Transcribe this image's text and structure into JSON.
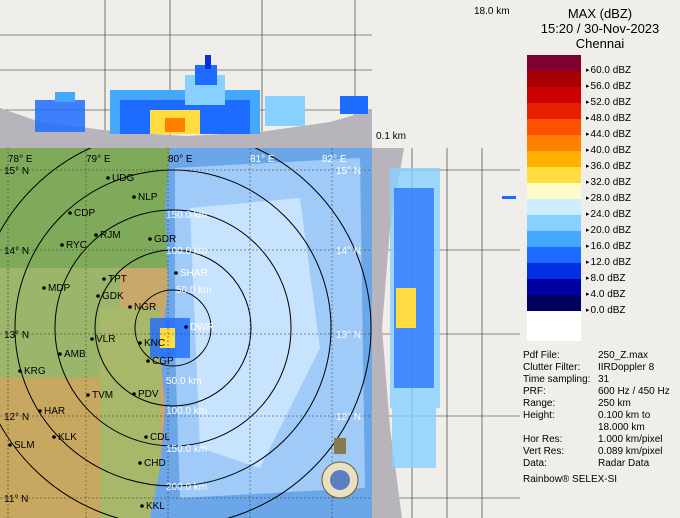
{
  "header": {
    "product": "MAX (dBZ)",
    "datetime": "15:20 / 30-Nov-2023",
    "station": "Chennai"
  },
  "scales": {
    "top_height_label": "18.0 km",
    "side_height_label": "0.1 km"
  },
  "legend": [
    {
      "label": "60.0 dBZ",
      "color": "#800030"
    },
    {
      "label": "56.0 dBZ",
      "color": "#a80000"
    },
    {
      "label": "52.0 dBZ",
      "color": "#cc0000"
    },
    {
      "label": "48.0 dBZ",
      "color": "#e82000"
    },
    {
      "label": "44.0 dBZ",
      "color": "#ff5000"
    },
    {
      "label": "40.0 dBZ",
      "color": "#ff8000"
    },
    {
      "label": "36.0 dBZ",
      "color": "#ffb000"
    },
    {
      "label": "32.0 dBZ",
      "color": "#ffdd40"
    },
    {
      "label": "28.0 dBZ",
      "color": "#fffbc8"
    },
    {
      "label": "24.0 dBZ",
      "color": "#cceeff"
    },
    {
      "label": "20.0 dBZ",
      "color": "#88d0ff"
    },
    {
      "label": "16.0 dBZ",
      "color": "#44a8ff"
    },
    {
      "label": "12.0 dBZ",
      "color": "#1e6cff"
    },
    {
      "label": "8.0 dBZ",
      "color": "#0030e0"
    },
    {
      "label": "4.0 dBZ",
      "color": "#0000a0"
    },
    {
      "label": "0.0 dBZ",
      "color": "#000060"
    }
  ],
  "info": [
    {
      "key": "Pdf File:",
      "value": "250_Z.max"
    },
    {
      "key": "Clutter Filter:",
      "value": "IIRDoppler 8"
    },
    {
      "key": "Time sampling:",
      "value": "31"
    },
    {
      "key": "PRF:",
      "value": "600 Hz / 450 Hz"
    },
    {
      "key": "Range:",
      "value": "250 km"
    },
    {
      "key": "Height:",
      "value": "0.100 km to"
    },
    {
      "key": "",
      "value": "18.000 km"
    },
    {
      "key": "Hor Res:",
      "value": "1.000 km/pixel"
    },
    {
      "key": "Vert Res:",
      "value": "0.089 km/pixel"
    },
    {
      "key": "Data:",
      "value": "Radar Data"
    }
  ],
  "footer": "Rainbow® SELEX-SI",
  "map": {
    "lon_labels": [
      "78° E",
      "79° E",
      "80° E",
      "81° E",
      "82° E"
    ],
    "lat_labels": [
      "15° N",
      "14° N",
      "13° N",
      "12° N",
      "11° N"
    ],
    "range_labels": [
      "50.0 km",
      "100.0 km",
      "150.0 km",
      "200.0 km"
    ],
    "cities": [
      "UDG",
      "NLP",
      "CDP",
      "RJM",
      "GDR",
      "RYC",
      "TPT",
      "SHAR",
      "MDP",
      "GDK",
      "NGR",
      "AMB",
      "VLR",
      "KNC",
      "KRG",
      "CGP",
      "TVM",
      "PDV",
      "HAR",
      "DWR",
      "CDL",
      "KLK",
      "SLM",
      "CHD",
      "KKL"
    ]
  }
}
